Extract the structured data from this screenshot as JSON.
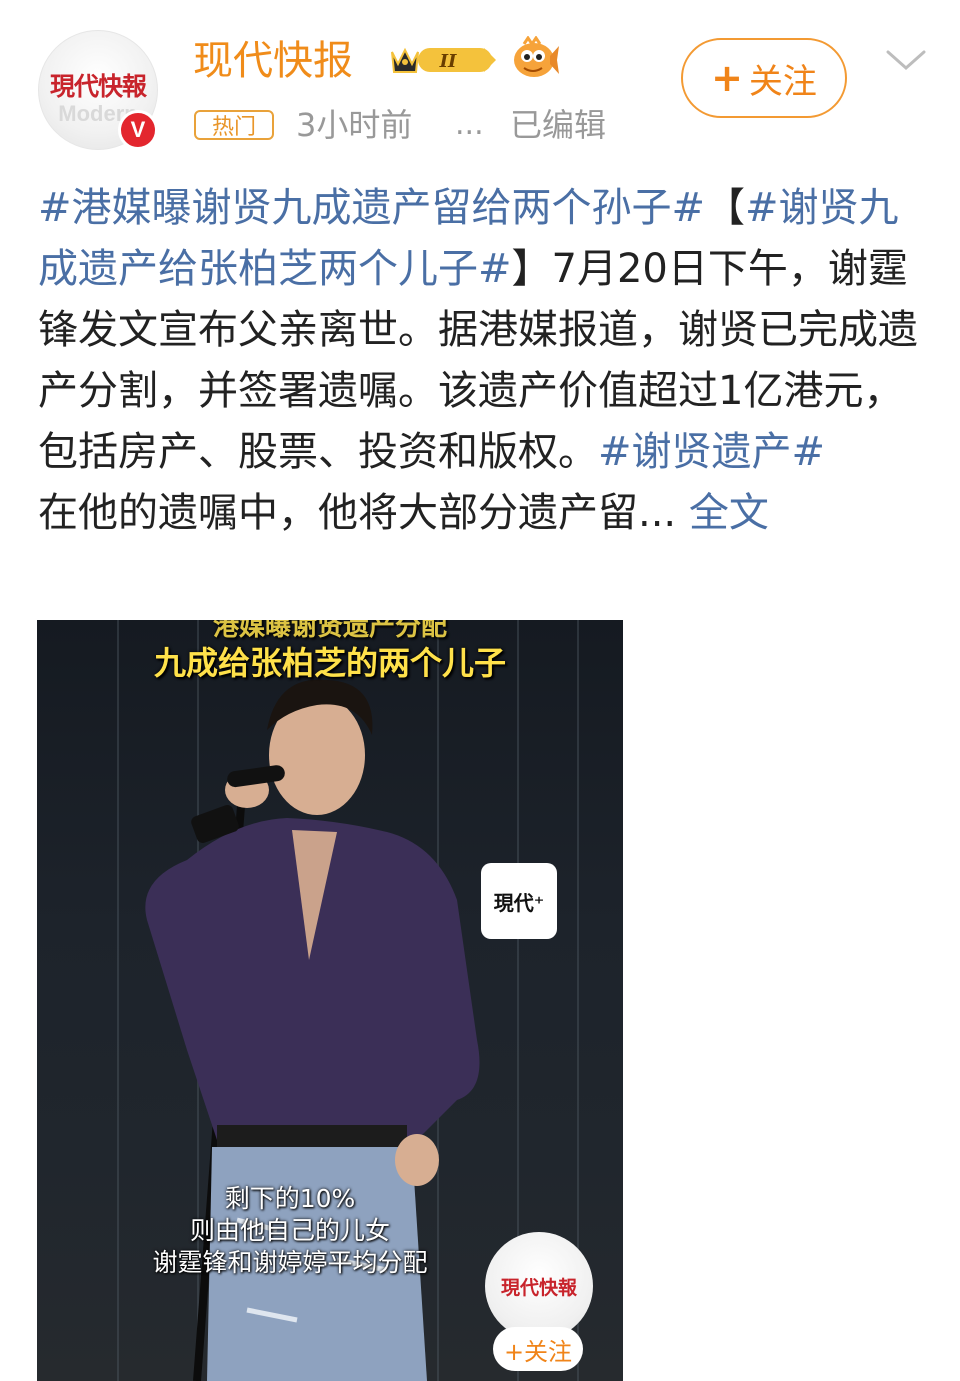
{
  "header": {
    "avatar_logo": "現代快報",
    "verify_mark": "V",
    "username": "现代快报",
    "level": "II",
    "hot_tag": "热门",
    "time": "3小时前",
    "more": "...",
    "edited": "已编辑",
    "follow_label": "关注",
    "follow_plus": "+"
  },
  "post": {
    "tag1": "#港媒曝谢贤九成遗产留给两个孙子#",
    "bracket_open": "【",
    "tag2": "#谢贤九成遗产给张柏芝两个儿子#",
    "text1": "】7月20日下午，谢霆锋发文宣布父亲离世。据港媒报道，谢贤已完成遗产分割，并签署遗嘱。该遗产价值超过1亿港元，包括房产、股票、投资和版权。",
    "tag3": "#谢贤遗产#",
    "text2": "在他的遗嘱中，他将大部分遗产留...",
    "more_label": " 全文"
  },
  "media": {
    "caption_top": "港媒曝谢贤遗产分配",
    "caption_main": "九成给张柏芝的两个儿子",
    "watermark": "現代⁺",
    "subtitle1": "剩下的10%",
    "subtitle2": "则由他自己的儿女",
    "subtitle3": "谢霆锋和谢婷婷平均分配",
    "avatar_logo": "現代快報",
    "follow_label": "+关注"
  },
  "colors": {
    "brand_orange": "#f08c1a",
    "link_blue": "#4a6fa5",
    "verify_red": "#e3262e",
    "caption_yellow": "#ffe14a"
  },
  "icons": {
    "level": "crown-level-badge",
    "fish": "fish-emoji-icon",
    "chevron": "chevron-down-icon"
  }
}
